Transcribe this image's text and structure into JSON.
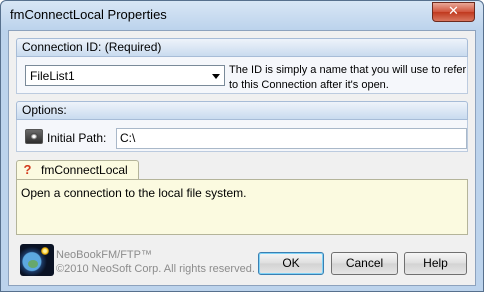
{
  "window": {
    "title": "fmConnectLocal Properties",
    "close_glyph": "✕"
  },
  "connection": {
    "header": "Connection ID: (Required)",
    "value": "FileList1",
    "hint": "The ID is simply a name that you will use to refer to this Connection after it's open."
  },
  "options": {
    "header": "Options:",
    "path_label": "Initial Path:",
    "path_value": "C:\\",
    "path_icon": "eye-icon"
  },
  "help": {
    "tab_label": "fmConnectLocal",
    "tab_icon": "question-icon",
    "description": "Open a connection to the local file system."
  },
  "footer": {
    "product_name": "NeoBookFM/FTP™",
    "copyright": "©2010 NeoSoft Corp. All rights reserved."
  },
  "buttons": {
    "ok": "OK",
    "cancel": "Cancel",
    "help": "Help"
  },
  "colors": {
    "accent": "#3c7fb1",
    "help_background": "#fbfae0",
    "close_button": "#c0391e"
  }
}
